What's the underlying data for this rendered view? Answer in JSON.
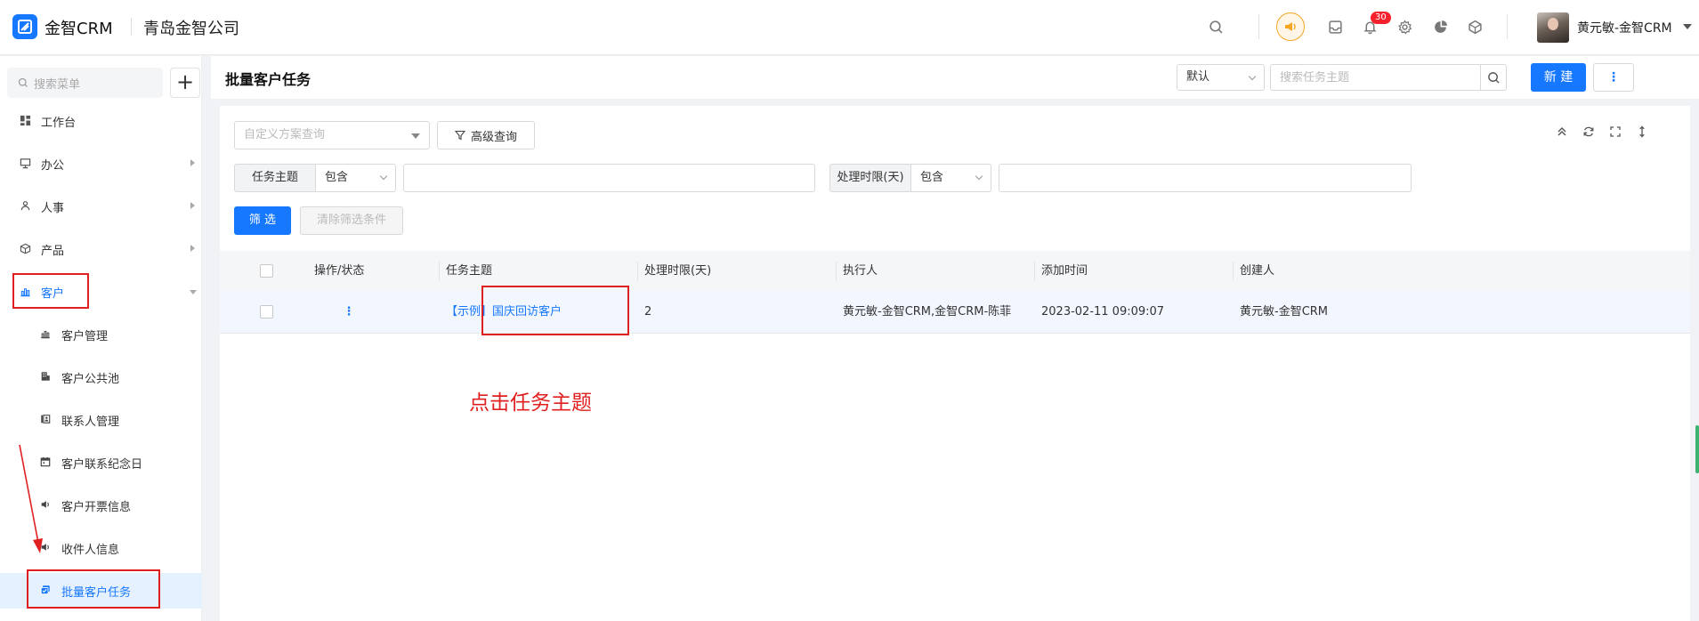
{
  "app": {
    "brand": "金智CRM",
    "company": "青岛金智公司",
    "notification_count": "30",
    "user_name": "黄元敏-金智CRM"
  },
  "sidebar": {
    "search_placeholder": "搜索菜单",
    "add_label": "+",
    "items": [
      {
        "label": "工作台",
        "icon": "dashboard-icon"
      },
      {
        "label": "办公",
        "icon": "monitor-icon"
      },
      {
        "label": "人事",
        "icon": "people-icon"
      },
      {
        "label": "产品",
        "icon": "box-icon"
      },
      {
        "label": "客户",
        "icon": "chart-icon"
      }
    ],
    "sub_items": [
      {
        "label": "客户管理",
        "icon": "chart-icon"
      },
      {
        "label": "客户公共池",
        "icon": "building-icon"
      },
      {
        "label": "联系人管理",
        "icon": "contact-card-icon"
      },
      {
        "label": "客户联系纪念日",
        "icon": "calendar-icon"
      },
      {
        "label": "客户开票信息",
        "icon": "speaker-icon"
      },
      {
        "label": "收件人信息",
        "icon": "speaker-icon"
      },
      {
        "label": "批量客户任务",
        "icon": "tasks-icon"
      }
    ]
  },
  "header": {
    "title": "批量客户任务",
    "view_select": "默认",
    "search_placeholder": "搜索任务主题",
    "new_button": "新 建",
    "more_button": "⋮"
  },
  "filters": {
    "scheme_placeholder": "自定义方案查询",
    "advanced_label": "高级查询",
    "field1_label": "任务主题",
    "field1_op": "包含",
    "field2_label": "处理时限(天)",
    "field2_op": "包含",
    "filter_button": "筛 选",
    "clear_button": "清除筛选条件"
  },
  "table": {
    "columns": [
      "操作/状态",
      "任务主题",
      "处理时限(天)",
      "执行人",
      "添加时间",
      "创建人"
    ],
    "rows": [
      {
        "menu": "⋮",
        "subject": "【示例】国庆回访客户",
        "deadline": "2",
        "executor": "黄元敏-金智CRM,金智CRM-陈菲",
        "added": "2023-02-11 09:09:07",
        "creator": "黄元敏-金智CRM"
      }
    ]
  },
  "annotation": "点击任务主题",
  "colors": {
    "primary": "#1677ff",
    "annotation_red": "#e02020",
    "badge_red": "#f5222d",
    "horn_orange": "#f5a623"
  }
}
